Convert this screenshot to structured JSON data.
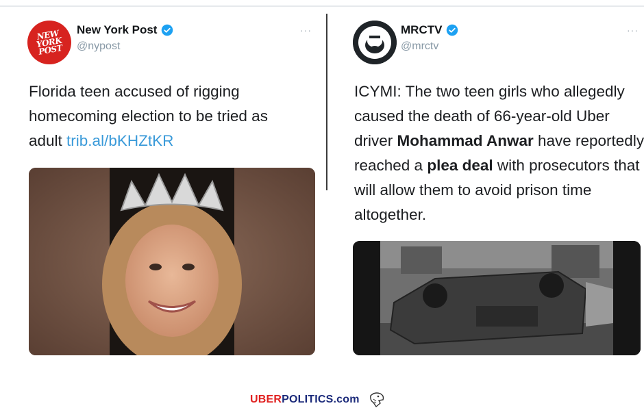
{
  "tweets": [
    {
      "name": "New York Post",
      "handle": "@nypost",
      "avatar_text": [
        "NEW",
        "YORK",
        "POST"
      ],
      "body_lines": [
        "Florida teen accused of rigging",
        "homecoming election to be tried as",
        "adult "
      ],
      "link": "trib.al/bKHZtKR",
      "media_icon": "homecoming-queen-photo"
    },
    {
      "name": "MRCTV",
      "handle": "@mrctv",
      "body": {
        "p1": "ICYMI: The two teen girls who allegedly caused the death of 66-year-old Uber driver ",
        "b1": "Mohammad Anwar",
        "p2": " have reportedly reached a ",
        "b2": "plea deal",
        "p3": " with prosecutors that will allow them to avoid prison time altogether."
      },
      "media_icon": "overturned-car-photo"
    }
  ],
  "more_label": "···",
  "footer": {
    "site_red": "UBER",
    "site_blue": "POLITICS.com"
  },
  "colors": {
    "verified": "#1da1f2",
    "link": "#3a9ad9",
    "nyp_red": "#d7231f",
    "uber_red": "#e0201f",
    "politics_blue": "#1b2a7a"
  }
}
